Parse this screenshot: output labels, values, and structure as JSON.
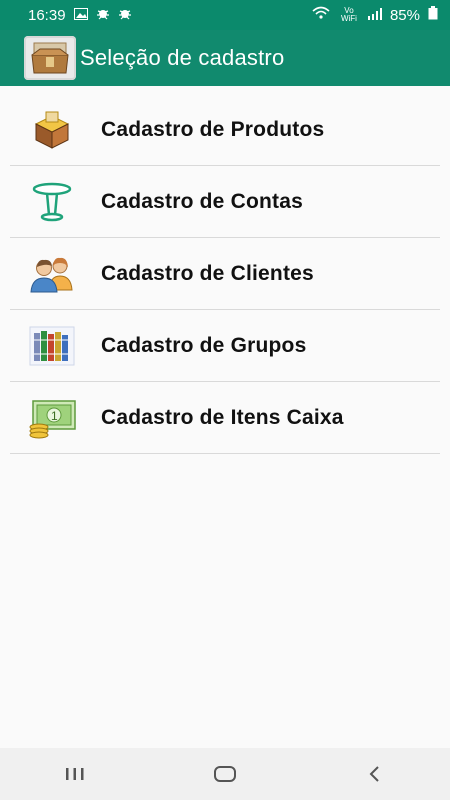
{
  "status_bar": {
    "time": "16:39",
    "network_label": "Vo)\nWiFi",
    "signal_text": "Vo WiFi",
    "battery": "85%"
  },
  "app_bar": {
    "title": "Seleção de cadastro",
    "logo_icon": "box-icon"
  },
  "menu": {
    "items": [
      {
        "label": "Cadastro de Produtos",
        "icon": "package-icon"
      },
      {
        "label": "Cadastro de Contas",
        "icon": "table-icon"
      },
      {
        "label": "Cadastro de Clientes",
        "icon": "users-icon"
      },
      {
        "label": "Cadastro de Grupos",
        "icon": "books-icon"
      },
      {
        "label": "Cadastro de Itens Caixa",
        "icon": "money-icon"
      }
    ]
  },
  "colors": {
    "primary": "#118a6e",
    "status": "#0b8a6c",
    "background": "#fafafa",
    "divider": "#d9d9d9"
  }
}
